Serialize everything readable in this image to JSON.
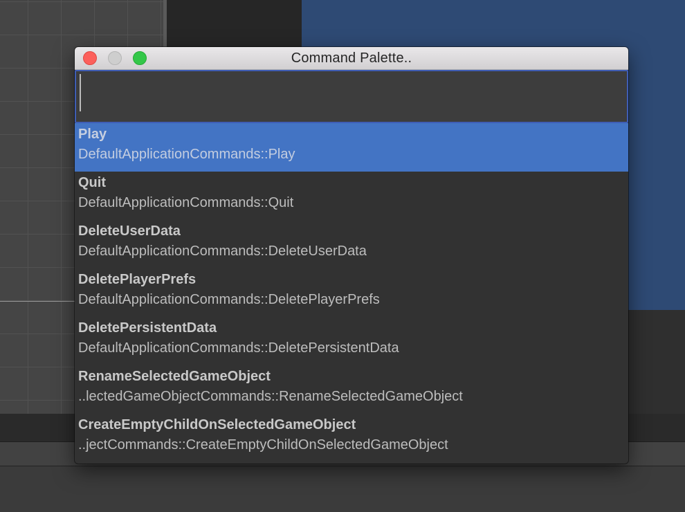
{
  "window": {
    "title": "Command Palette..",
    "accent_color": "#4374c4",
    "search_border_color": "#3f5db4"
  },
  "search": {
    "value": "",
    "placeholder": ""
  },
  "results": [
    {
      "title": "Play",
      "path": "DefaultApplicationCommands::Play",
      "selected": true
    },
    {
      "title": "Quit",
      "path": "DefaultApplicationCommands::Quit",
      "selected": false
    },
    {
      "title": "DeleteUserData",
      "path": "DefaultApplicationCommands::DeleteUserData",
      "selected": false
    },
    {
      "title": "DeletePlayerPrefs",
      "path": "DefaultApplicationCommands::DeletePlayerPrefs",
      "selected": false
    },
    {
      "title": "DeletePersistentData",
      "path": "DefaultApplicationCommands::DeletePersistentData",
      "selected": false
    },
    {
      "title": "RenameSelectedGameObject",
      "path": "..lectedGameObjectCommands::RenameSelectedGameObject",
      "selected": false
    },
    {
      "title": "CreateEmptyChildOnSelectedGameObject",
      "path": "..jectCommands::CreateEmptyChildOnSelectedGameObject",
      "selected": false
    }
  ]
}
